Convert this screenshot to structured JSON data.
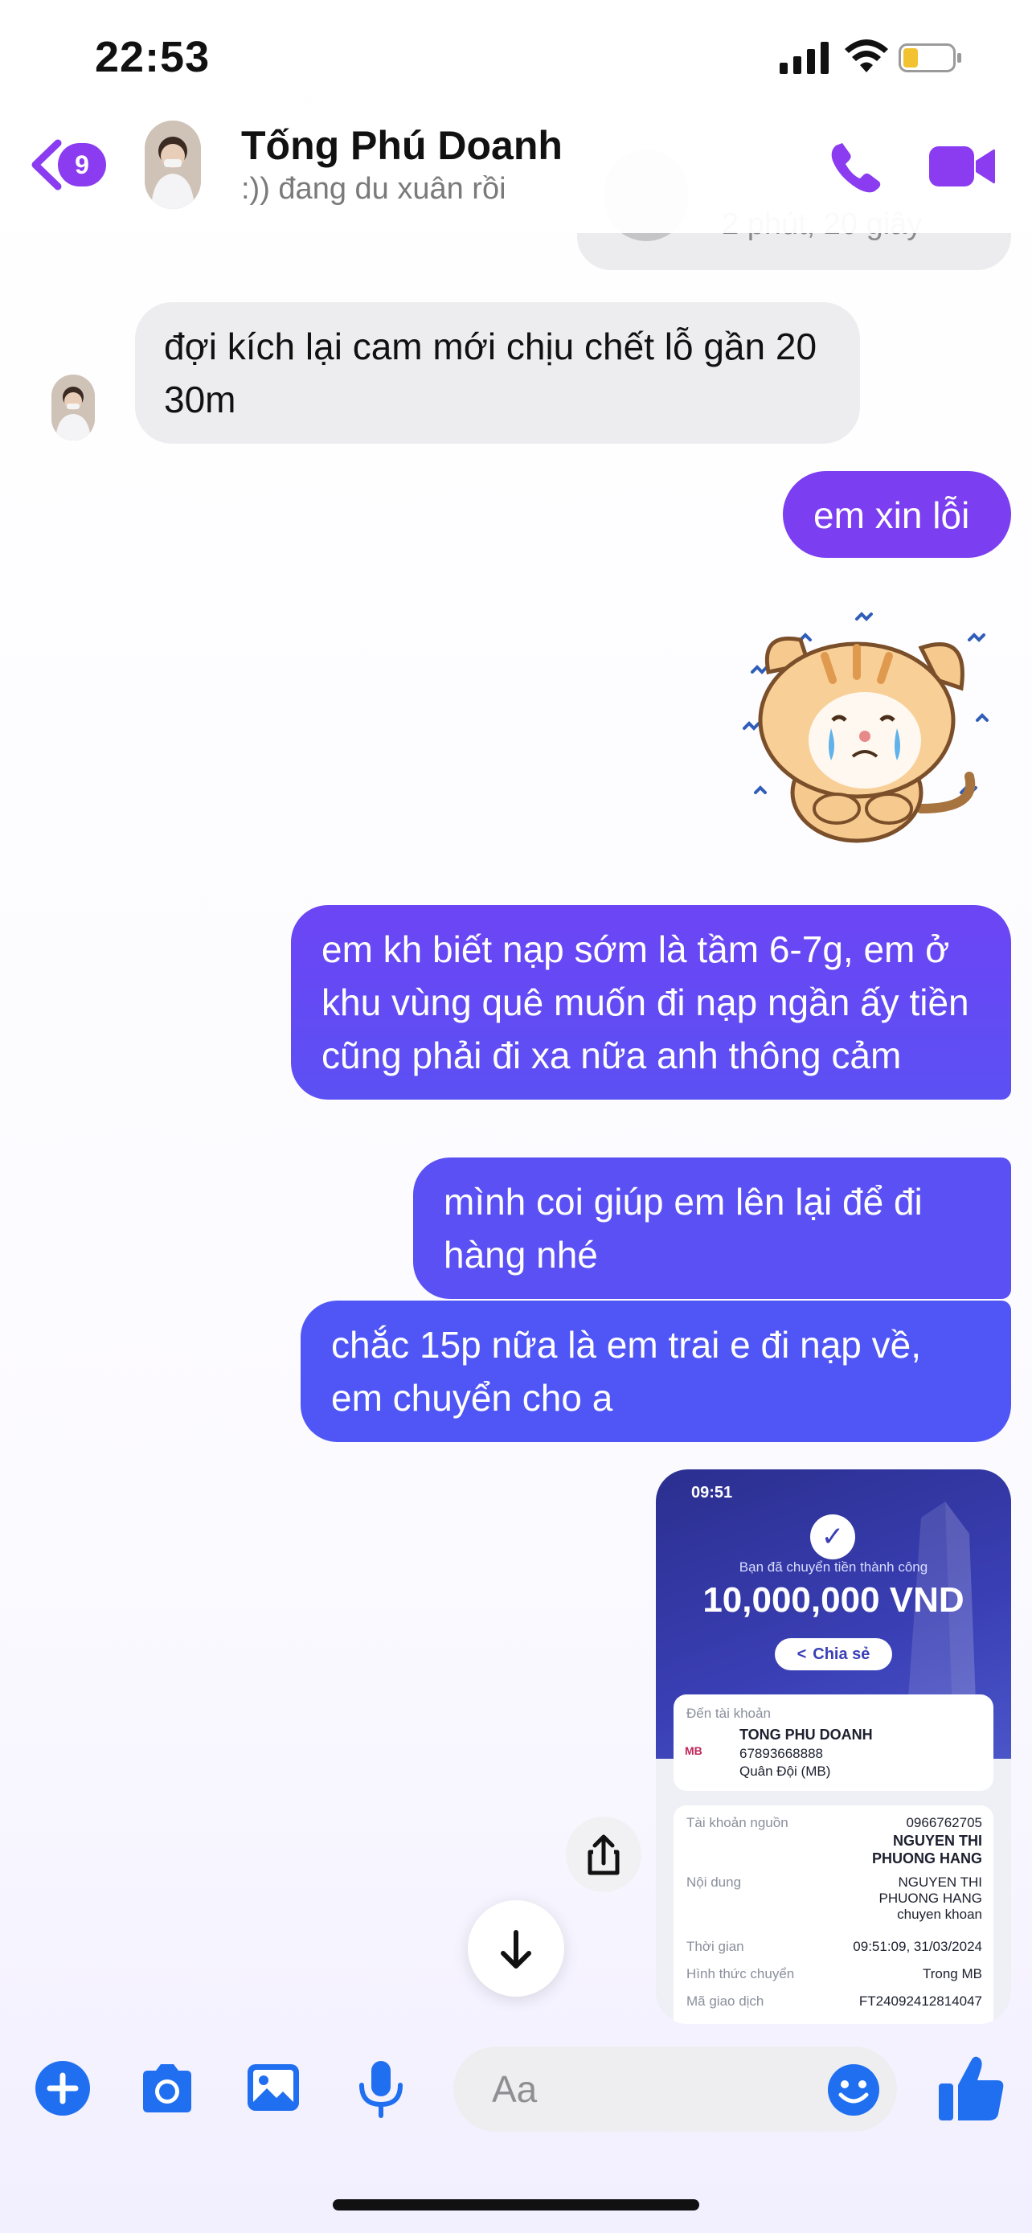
{
  "status_bar": {
    "time": "22:53"
  },
  "header": {
    "back_badge": "9",
    "contact_name": "Tống Phú Doanh",
    "contact_status": ":)) đang du xuân rồi"
  },
  "call_bubble": {
    "duration": "2 phút, 20 giây"
  },
  "messages": {
    "incoming_1": "đợi kích lại cam mới chịu chết lỗ gần 20 30m",
    "outgoing_1": "em xin lỗi",
    "outgoing_2": "em kh biết nạp sớm là tầm 6-7g, em ở khu vùng quê muốn đi nạp ngần ấy tiền cũng phải đi xa nữa anh thông cảm",
    "outgoing_3": "mình coi giúp em lên lại để đi hàng nhé",
    "outgoing_4": "chắc 15p nữa là em trai e đi nạp về, em chuyển cho a"
  },
  "transfer_image": {
    "time": "09:51",
    "caption": "Bạn đã chuyển tiền thành công",
    "amount": "10,000,000 VND",
    "share_label": "Chia sẻ",
    "to_label": "Đến tài khoản",
    "to_name": "TONG PHU DOANH",
    "to_account": "67893668888",
    "to_bank": "Quân Đội (MB)",
    "bank_logo": "MB",
    "source_label": "Tài khoản nguồn",
    "source_account": "0966762705",
    "source_name_1": "NGUYEN THI",
    "source_name_2": "PHUONG HANG",
    "content_label": "Nội dung",
    "content_1": "NGUYEN THI",
    "content_2": "PHUONG HANG",
    "content_3": "chuyen khoan",
    "time_label": "Thời gian",
    "time_value": "09:51:09, 31/03/2024",
    "method_label": "Hình thức chuyển",
    "method_value": "Trong MB",
    "ref_label": "Mã giao dịch",
    "ref_value": "FT24092412814047"
  },
  "composer": {
    "placeholder": "Aa"
  },
  "colors": {
    "accent": "#8b3cf0",
    "outgoing_top": "#7b3ef0",
    "outgoing_bottom": "#4f56f5",
    "incoming": "#ededef",
    "composer_icons": "#1f6ff0"
  },
  "icons": [
    "back-chevron-icon",
    "phone-icon",
    "video-camera-icon",
    "plus-icon",
    "camera-icon",
    "photo-icon",
    "microphone-icon",
    "emoji-icon",
    "thumbs-up-icon",
    "share-icon",
    "arrow-down-icon"
  ]
}
